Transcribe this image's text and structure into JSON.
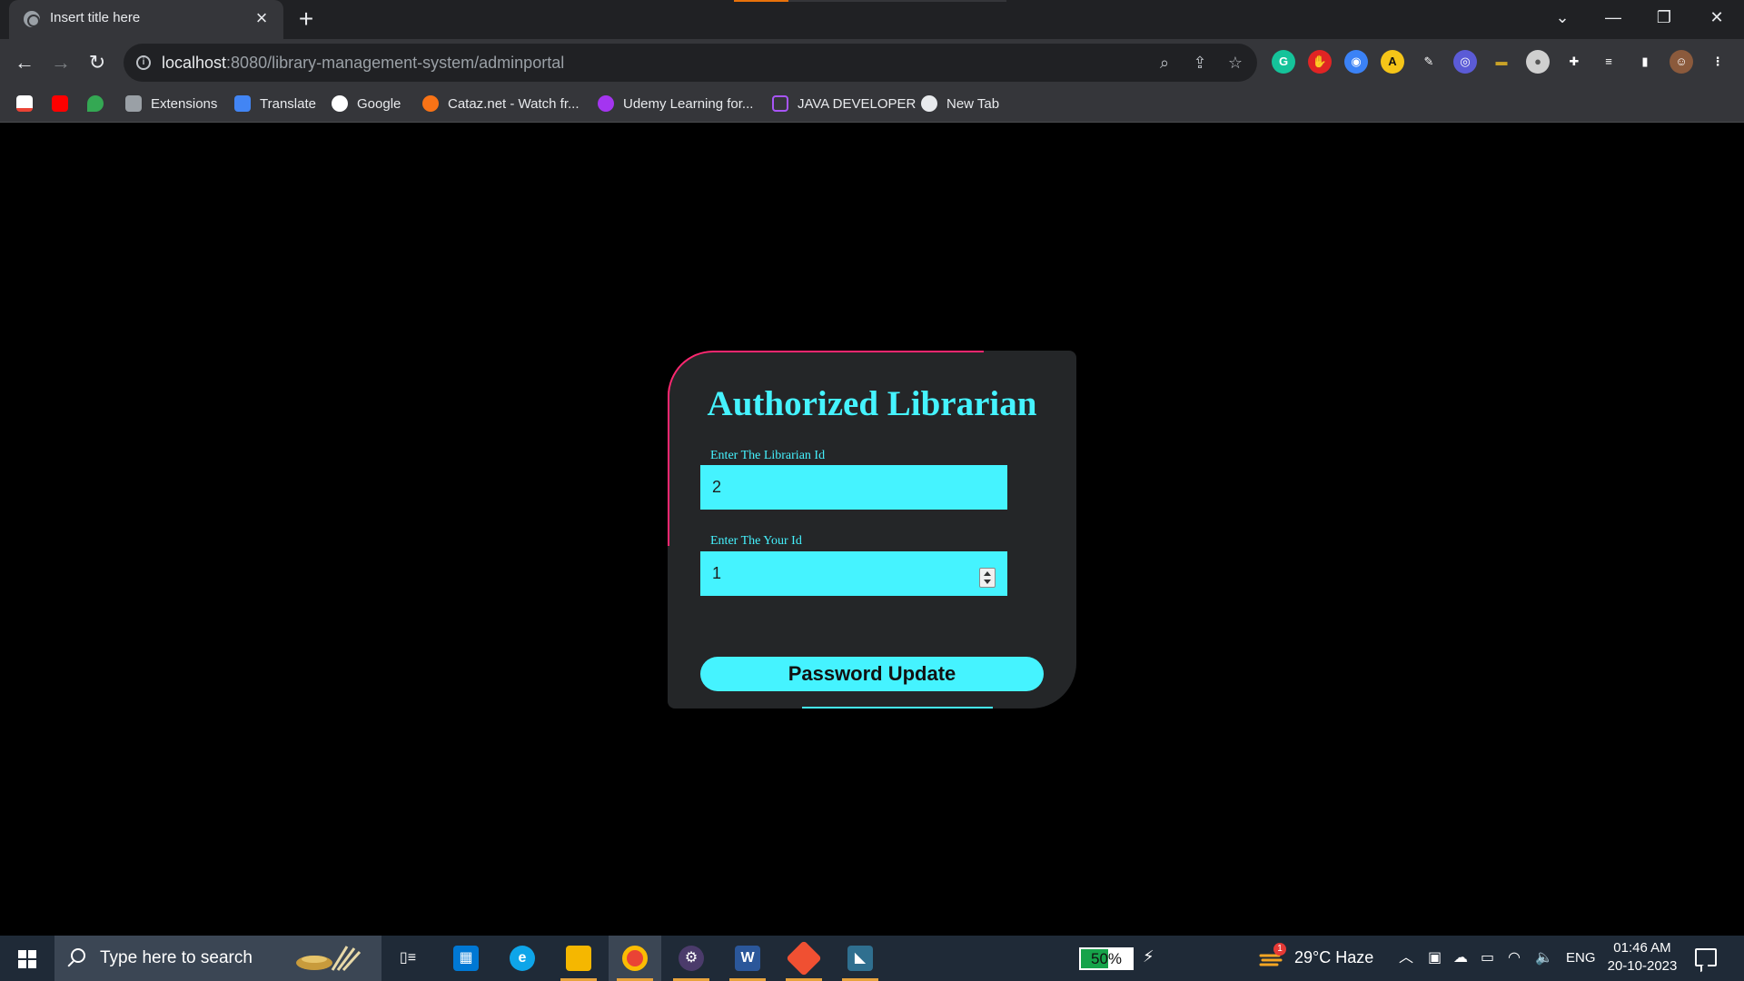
{
  "browser": {
    "tab_title": "Insert title here",
    "url_host": "localhost",
    "url_rest": ":8080/library-management-system/adminportal",
    "bookmarks": [
      "Extensions",
      "Translate",
      "Google",
      "Cataz.net - Watch fr...",
      "Udemy Learning for...",
      "JAVA DEVELOPER",
      "New Tab"
    ]
  },
  "page": {
    "title": "Authorized Librarian",
    "librarian_id_label": "Enter The Librarian Id",
    "librarian_id_value": "2",
    "your_id_label": "Enter The Your Id",
    "your_id_value": "1",
    "submit_label": "Password Update"
  },
  "taskbar": {
    "search_placeholder": "Type here to search",
    "battery": "50%",
    "weather": "29°C  Haze",
    "weather_alert_count": "1",
    "language": "ENG",
    "time": "01:46 AM",
    "date": "20-10-2023"
  },
  "colors": {
    "accent_cyan": "#45f3ff",
    "accent_pink": "#ff2770",
    "card_bg": "#242628",
    "page_bg": "#000000"
  }
}
